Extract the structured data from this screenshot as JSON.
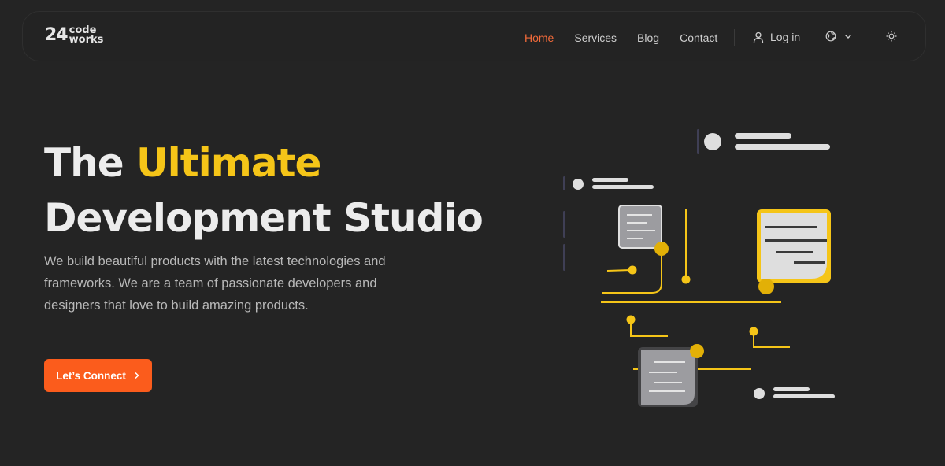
{
  "brand": {
    "number": "24",
    "word1": "code",
    "word2": "works"
  },
  "nav": {
    "items": [
      {
        "label": "Home",
        "active": true
      },
      {
        "label": "Services",
        "active": false
      },
      {
        "label": "Blog",
        "active": false
      },
      {
        "label": "Contact",
        "active": false
      }
    ],
    "login_label": "Log in",
    "language_icon": "globe-icon",
    "theme_icon": "sun-icon"
  },
  "hero": {
    "title_part1": "The ",
    "title_accent": "Ultimate",
    "title_line2": "Development Studio",
    "description": "We build beautiful products with the latest technologies and frameworks. We are a team of passionate developers and designers that love to build amazing products.",
    "cta_label": "Let’s Connect"
  },
  "colors": {
    "background": "#242424",
    "accent_orange": "#fb5c1c",
    "accent_yellow": "#f5c518",
    "active_link": "#f26a3a"
  }
}
